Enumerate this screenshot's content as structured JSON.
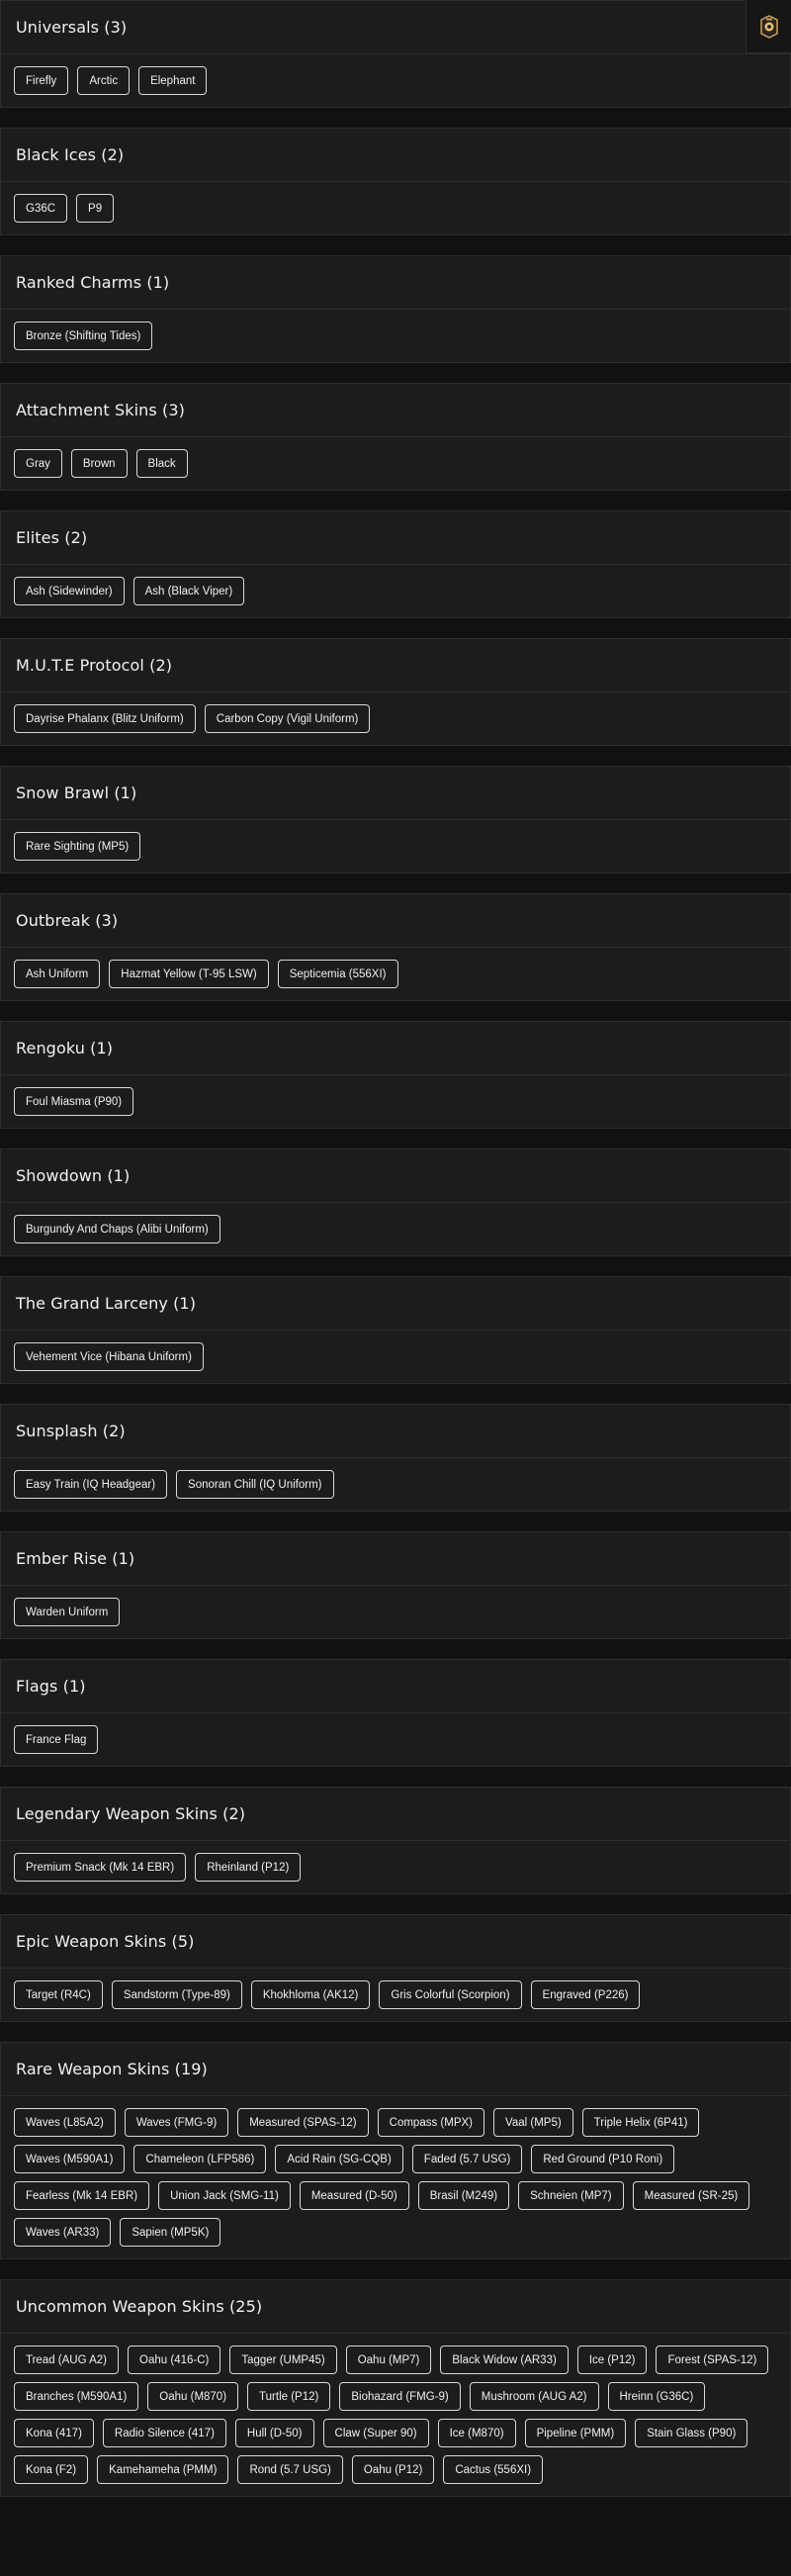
{
  "corner_icon": "operator-badge-icon",
  "sections": [
    {
      "title": "Universals (3)",
      "items": [
        "Firefly",
        "Arctic",
        "Elephant"
      ]
    },
    {
      "title": "Black Ices (2)",
      "items": [
        "G36C",
        "P9"
      ]
    },
    {
      "title": "Ranked Charms (1)",
      "items": [
        "Bronze (Shifting Tides)"
      ]
    },
    {
      "title": "Attachment Skins (3)",
      "items": [
        "Gray",
        "Brown",
        "Black"
      ]
    },
    {
      "title": "Elites (2)",
      "items": [
        "Ash (Sidewinder)",
        "Ash (Black Viper)"
      ]
    },
    {
      "title": "M.U.T.E Protocol (2)",
      "items": [
        "Dayrise Phalanx (Blitz Uniform)",
        "Carbon Copy (Vigil Uniform)"
      ]
    },
    {
      "title": "Snow Brawl (1)",
      "items": [
        "Rare Sighting (MP5)"
      ]
    },
    {
      "title": "Outbreak (3)",
      "items": [
        "Ash Uniform",
        "Hazmat Yellow (T-95 LSW)",
        "Septicemia (556XI)"
      ]
    },
    {
      "title": "Rengoku (1)",
      "items": [
        "Foul Miasma (P90)"
      ]
    },
    {
      "title": "Showdown (1)",
      "items": [
        "Burgundy And Chaps (Alibi Uniform)"
      ]
    },
    {
      "title": "The Grand Larceny (1)",
      "items": [
        "Vehement Vice (Hibana Uniform)"
      ]
    },
    {
      "title": "Sunsplash (2)",
      "items": [
        "Easy Train (IQ Headgear)",
        "Sonoran Chill (IQ Uniform)"
      ]
    },
    {
      "title": "Ember Rise (1)",
      "items": [
        "Warden Uniform"
      ]
    },
    {
      "title": "Flags (1)",
      "items": [
        "France Flag"
      ]
    },
    {
      "title": "Legendary Weapon Skins (2)",
      "items": [
        "Premium Snack (Mk 14 EBR)",
        "Rheinland (P12)"
      ]
    },
    {
      "title": "Epic Weapon Skins (5)",
      "items": [
        "Target (R4C)",
        "Sandstorm (Type-89)",
        "Khokhloma (AK12)",
        "Gris Colorful (Scorpion)",
        "Engraved (P226)"
      ]
    },
    {
      "title": "Rare Weapon Skins (19)",
      "items": [
        "Waves (L85A2)",
        "Waves (FMG-9)",
        "Measured (SPAS-12)",
        "Compass (MPX)",
        "Vaal (MP5)",
        "Triple Helix (6P41)",
        "Waves (M590A1)",
        "Chameleon (LFP586)",
        "Acid Rain (SG-CQB)",
        "Faded (5.7 USG)",
        "Red Ground (P10 Roni)",
        "Fearless (Mk 14 EBR)",
        "Union Jack (SMG-11)",
        "Measured (D-50)",
        "Brasil (M249)",
        "Schneien (MP7)",
        "Measured (SR-25)",
        "Waves (AR33)",
        "Sapien (MP5K)"
      ]
    },
    {
      "title": "Uncommon Weapon Skins (25)",
      "items": [
        "Tread (AUG A2)",
        "Oahu (416-C)",
        "Tagger (UMP45)",
        "Oahu (MP7)",
        "Black Widow (AR33)",
        "Ice (P12)",
        "Forest (SPAS-12)",
        "Branches (M590A1)",
        "Oahu (M870)",
        "Turtle (P12)",
        "Biohazard (FMG-9)",
        "Mushroom (AUG A2)",
        "Hreinn (G36C)",
        "Kona (417)",
        "Radio Silence (417)",
        "Hull (D-50)",
        "Claw (Super 90)",
        "Ice (M870)",
        "Pipeline (PMM)",
        "Stain Glass (P90)",
        "Kona (F2)",
        "Kamehameha (PMM)",
        "Rond (5.7 USG)",
        "Oahu (P12)",
        "Cactus (556XI)"
      ]
    }
  ]
}
